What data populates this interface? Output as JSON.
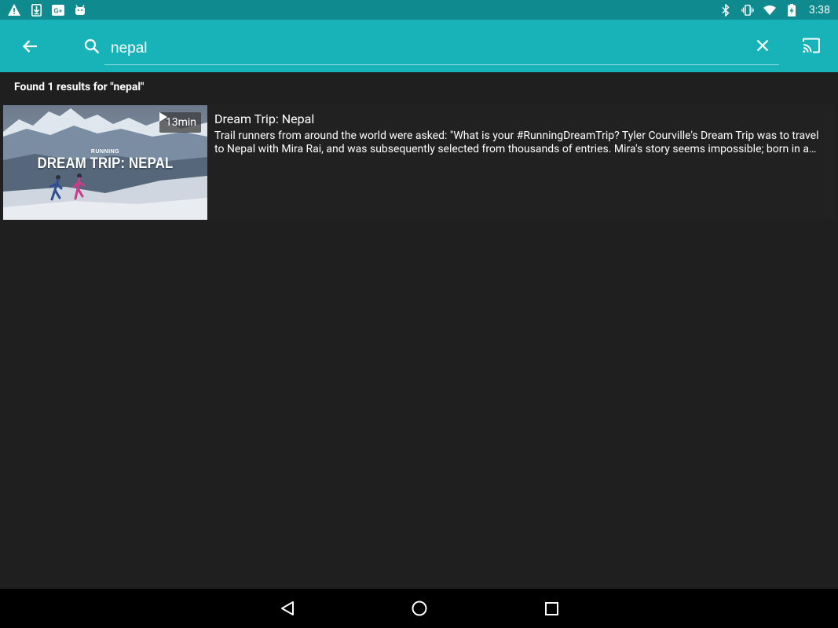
{
  "status_bar": {
    "time": "3:38",
    "left_icons": [
      "warning-icon",
      "download-icon",
      "google-plus-icon",
      "android-icon"
    ],
    "right_icons": [
      "bluetooth-icon",
      "vibrate-icon",
      "wifi-icon",
      "battery-charging-icon"
    ]
  },
  "app_bar": {
    "search_value": "nepal",
    "background": "#17b3b9"
  },
  "results": {
    "summary": "Found 1 results for \"nepal\"",
    "items": [
      {
        "title": "Dream Trip: Nepal",
        "description": "Trail runners from around the world were asked: \"What is your #RunningDreamTrip? Tyler Courville's Dream Trip was to travel to Nepal with Mira Rai, and was subsequently selected from thousands of entries. Mira's story seems impossible; born in a small village in the hills of eastern Nepal, she fought as a child soldier before discovering trail running.",
        "duration": "13min",
        "thumb_kicker": "RUNNING",
        "thumb_title": "DREAM TRIP: NEPAL"
      }
    ]
  },
  "colors": {
    "status_bar": "#0f8a8e",
    "app_bar": "#17b3b9",
    "background": "#1f1f1f"
  }
}
